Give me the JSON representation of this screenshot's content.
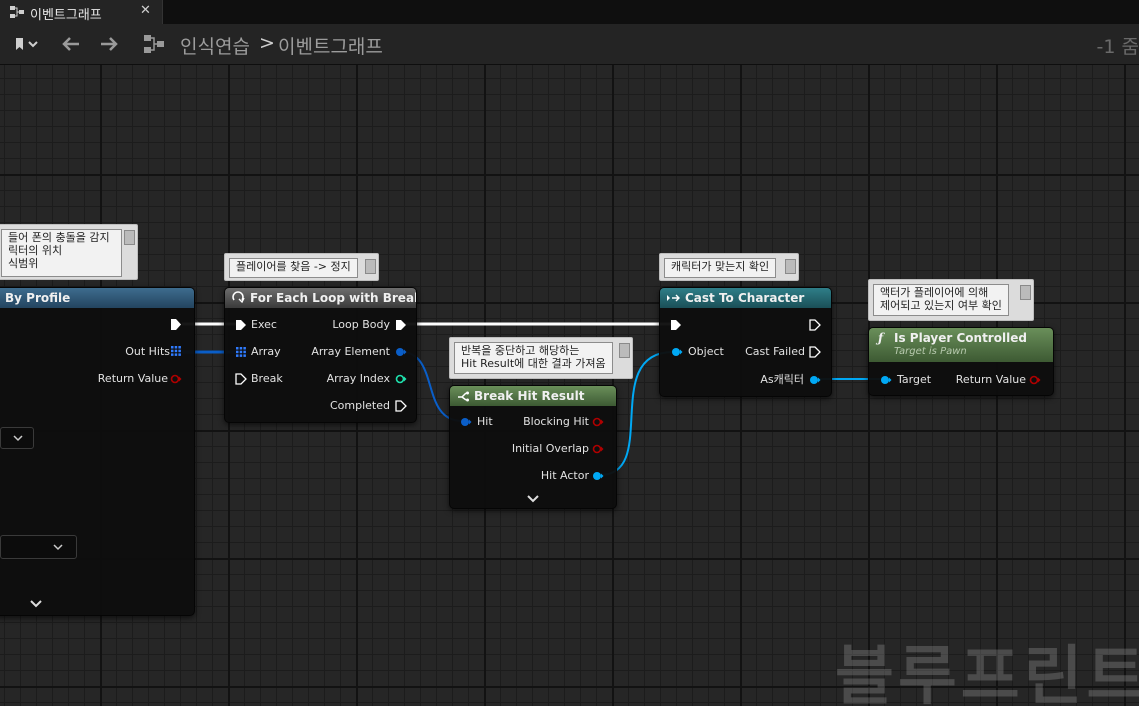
{
  "tab": {
    "title": "이벤트그래프",
    "close": "✕",
    "icon": "graph-icon"
  },
  "toolbar": {
    "breadcrumb": {
      "root": "인식연습",
      "separator": ">",
      "current": "이벤트그래프"
    },
    "zoom": "-1 줌"
  },
  "comments": {
    "left_partial": "들어 폰의 충돌을 감지\n릭터의 위치\n식범위",
    "foreach": "플레이어를 찾음 -> 정지",
    "break_hit": "반복을 중단하고 해당하는\nHit Result에 대한 결과 가져옴",
    "cast": "캐릭터가 맞는지 확인",
    "is_player": "액터가 플레이어에 의해\n제어되고 있는지 여부 확인"
  },
  "nodes": {
    "trace": {
      "title": "By Profile",
      "out_hits": "Out Hits",
      "return_value": "Return Value"
    },
    "foreach": {
      "title": "For Each Loop with Break",
      "exec": "Exec",
      "array": "Array",
      "break": "Break",
      "loop_body": "Loop Body",
      "array_element": "Array Element",
      "array_index": "Array Index",
      "completed": "Completed"
    },
    "break_hit": {
      "title": "Break Hit Result",
      "hit": "Hit",
      "blocking_hit": "Blocking Hit",
      "initial_overlap": "Initial Overlap",
      "hit_actor": "Hit Actor"
    },
    "cast": {
      "title": "Cast To Character",
      "object": "Object",
      "cast_failed": "Cast Failed",
      "as_character": "As캐릭터"
    },
    "is_player": {
      "title": "Is Player Controlled",
      "subtitle": "Target is Pawn",
      "target": "Target",
      "return_value": "Return Value"
    }
  },
  "watermark": "블루프린트",
  "colors": {
    "exec": "#ffffff",
    "object": "#00a8f4",
    "struct": "#0057c8",
    "bool": "#950000",
    "int": "#1fe3af"
  }
}
